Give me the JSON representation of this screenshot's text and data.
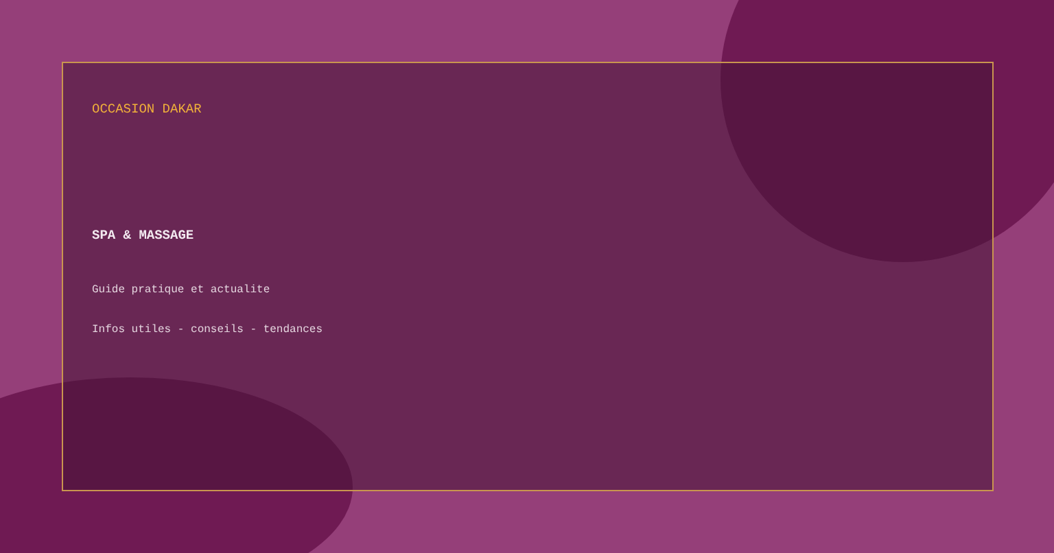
{
  "brand": "OCCASION DAKAR",
  "heading": "SPA & MASSAGE",
  "lines": [
    "Guide pratique et actualite",
    "Infos utiles - conseils - tendances"
  ]
}
